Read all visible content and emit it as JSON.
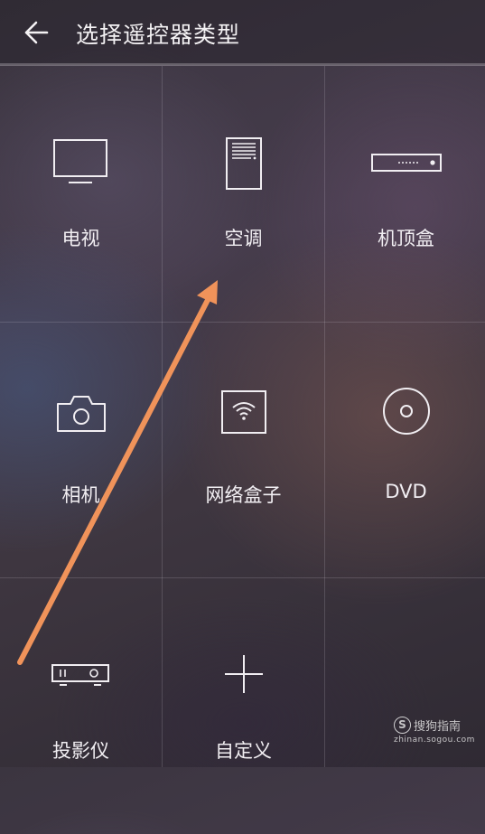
{
  "header": {
    "title": "选择遥控器类型",
    "back_icon": "back-arrow-icon"
  },
  "devices": [
    {
      "label": "电视",
      "icon": "tv-icon"
    },
    {
      "label": "空调",
      "icon": "air-conditioner-icon"
    },
    {
      "label": "机顶盒",
      "icon": "set-top-box-icon"
    },
    {
      "label": "相机",
      "icon": "camera-icon"
    },
    {
      "label": "网络盒子",
      "icon": "network-box-icon"
    },
    {
      "label": "DVD",
      "icon": "dvd-icon"
    },
    {
      "label": "投影仪",
      "icon": "projector-icon"
    },
    {
      "label": "自定义",
      "icon": "plus-icon"
    }
  ],
  "annotation": {
    "color": "#f0935a"
  },
  "watermark": {
    "logo": "S",
    "name": "搜狗指南",
    "domain": "zhinan.sogou.com"
  }
}
